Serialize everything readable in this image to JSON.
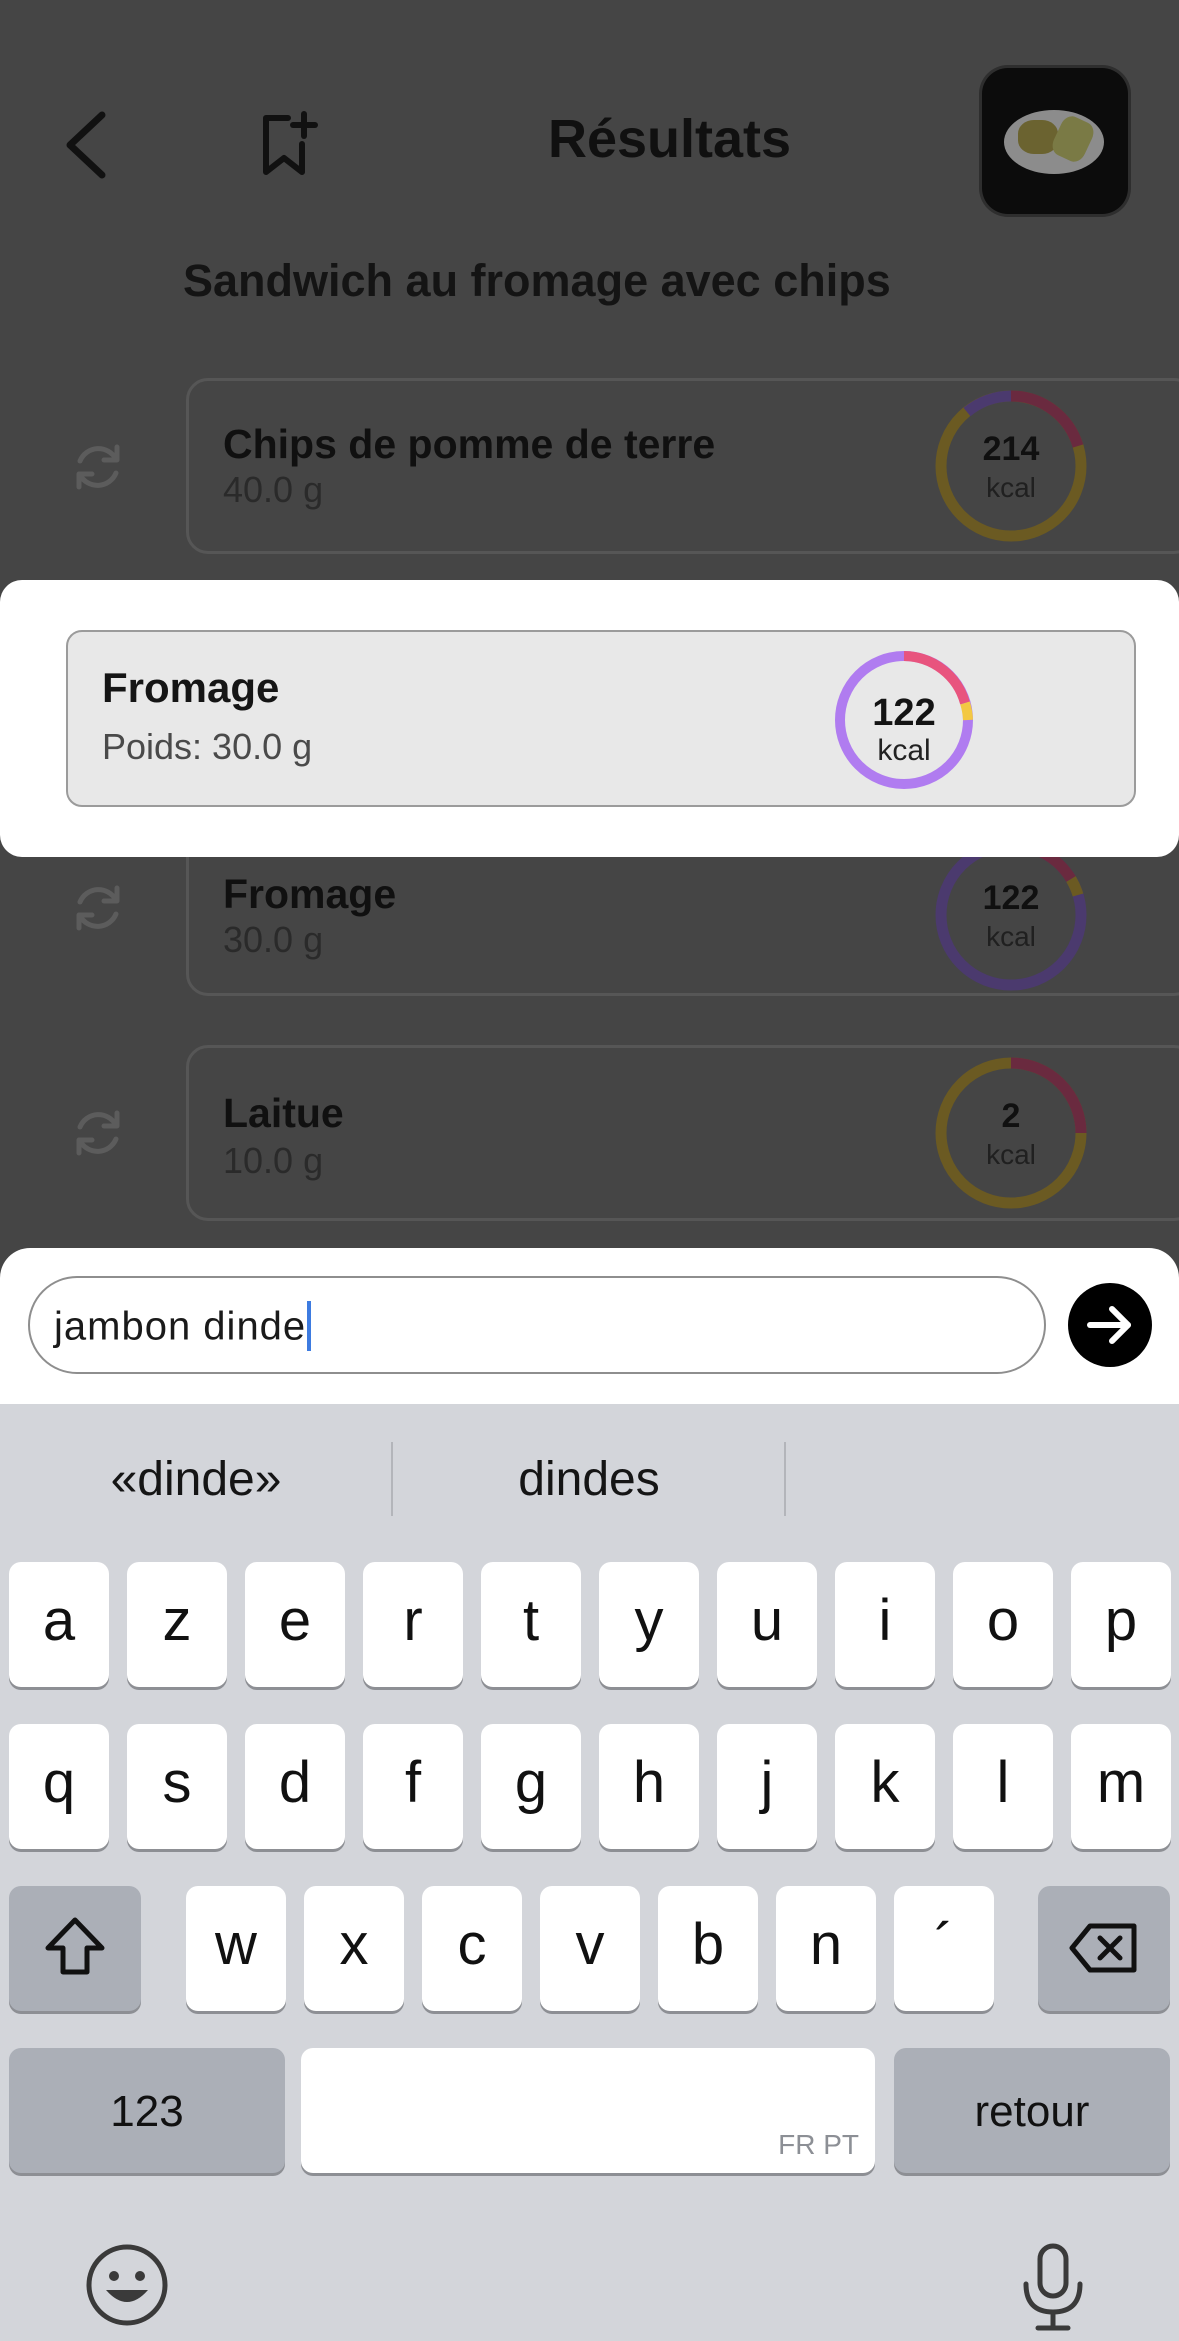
{
  "header": {
    "title": "Résultats",
    "meal_name": "Sandwich au fromage avec chips"
  },
  "food_items": [
    {
      "name": "Chips de pomme de terre",
      "weight": "40.0 g",
      "kcal": "214",
      "unit": "kcal"
    },
    {
      "name": "Fromage",
      "weight": "30.0 g",
      "kcal": "122",
      "unit": "kcal"
    },
    {
      "name": "Laitue",
      "weight": "10.0 g",
      "kcal": "2",
      "unit": "kcal"
    }
  ],
  "modal": {
    "name": "Fromage",
    "weight_label": "Poids: 30.0 g",
    "kcal": "122",
    "unit": "kcal"
  },
  "input": {
    "value": "jambon dinde"
  },
  "keyboard": {
    "suggestions": [
      "«dinde»",
      "dindes",
      ""
    ],
    "row1": [
      "a",
      "z",
      "e",
      "r",
      "t",
      "y",
      "u",
      "i",
      "o",
      "p"
    ],
    "row2": [
      "q",
      "s",
      "d",
      "f",
      "g",
      "h",
      "j",
      "k",
      "l",
      "m"
    ],
    "row3": [
      "w",
      "x",
      "c",
      "v",
      "b",
      "n",
      "´"
    ],
    "numbers_label": "123",
    "return_label": "retour",
    "space_hint": "FR PT"
  },
  "colors": {
    "ring_purple": "#b07cf0",
    "ring_pink": "#e8547e",
    "ring_yellow": "#f3c843",
    "caret": "#3d7be0"
  },
  "icons": [
    "back-icon",
    "bookmark-add-icon",
    "refresh-icon",
    "arrow-right-icon",
    "shift-icon",
    "backspace-icon",
    "emoji-icon",
    "microphone-icon"
  ]
}
